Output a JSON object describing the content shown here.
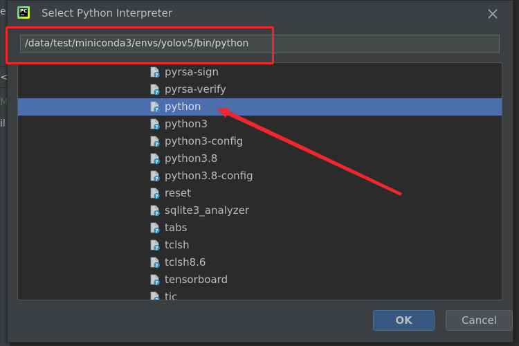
{
  "background": {
    "fragments": [
      "er",
      "<",
      "M",
      "il"
    ]
  },
  "dialog": {
    "title": "Select Python Interpreter",
    "app_icon_text": "PC",
    "path_value": "/data/test/miniconda3/envs/yolov5/bin/python",
    "ok_label": "OK",
    "cancel_label": "Cancel"
  },
  "tree": {
    "items": [
      {
        "label": "pyrsa-sign",
        "selected": false
      },
      {
        "label": "pyrsa-verify",
        "selected": false
      },
      {
        "label": "python",
        "selected": true
      },
      {
        "label": "python3",
        "selected": false
      },
      {
        "label": "python3-config",
        "selected": false
      },
      {
        "label": "python3.8",
        "selected": false
      },
      {
        "label": "python3.8-config",
        "selected": false
      },
      {
        "label": "reset",
        "selected": false
      },
      {
        "label": "sqlite3_analyzer",
        "selected": false
      },
      {
        "label": "tabs",
        "selected": false
      },
      {
        "label": "tclsh",
        "selected": false
      },
      {
        "label": "tclsh8.6",
        "selected": false
      },
      {
        "label": "tensorboard",
        "selected": false
      },
      {
        "label": "tic",
        "selected": false
      }
    ]
  },
  "colors": {
    "dialog_bg": "#3c3f41",
    "tree_bg": "#2b2b2b",
    "selection": "#4b6eaf",
    "annotation_red": "#f2262b",
    "ok_button": "#365880"
  }
}
